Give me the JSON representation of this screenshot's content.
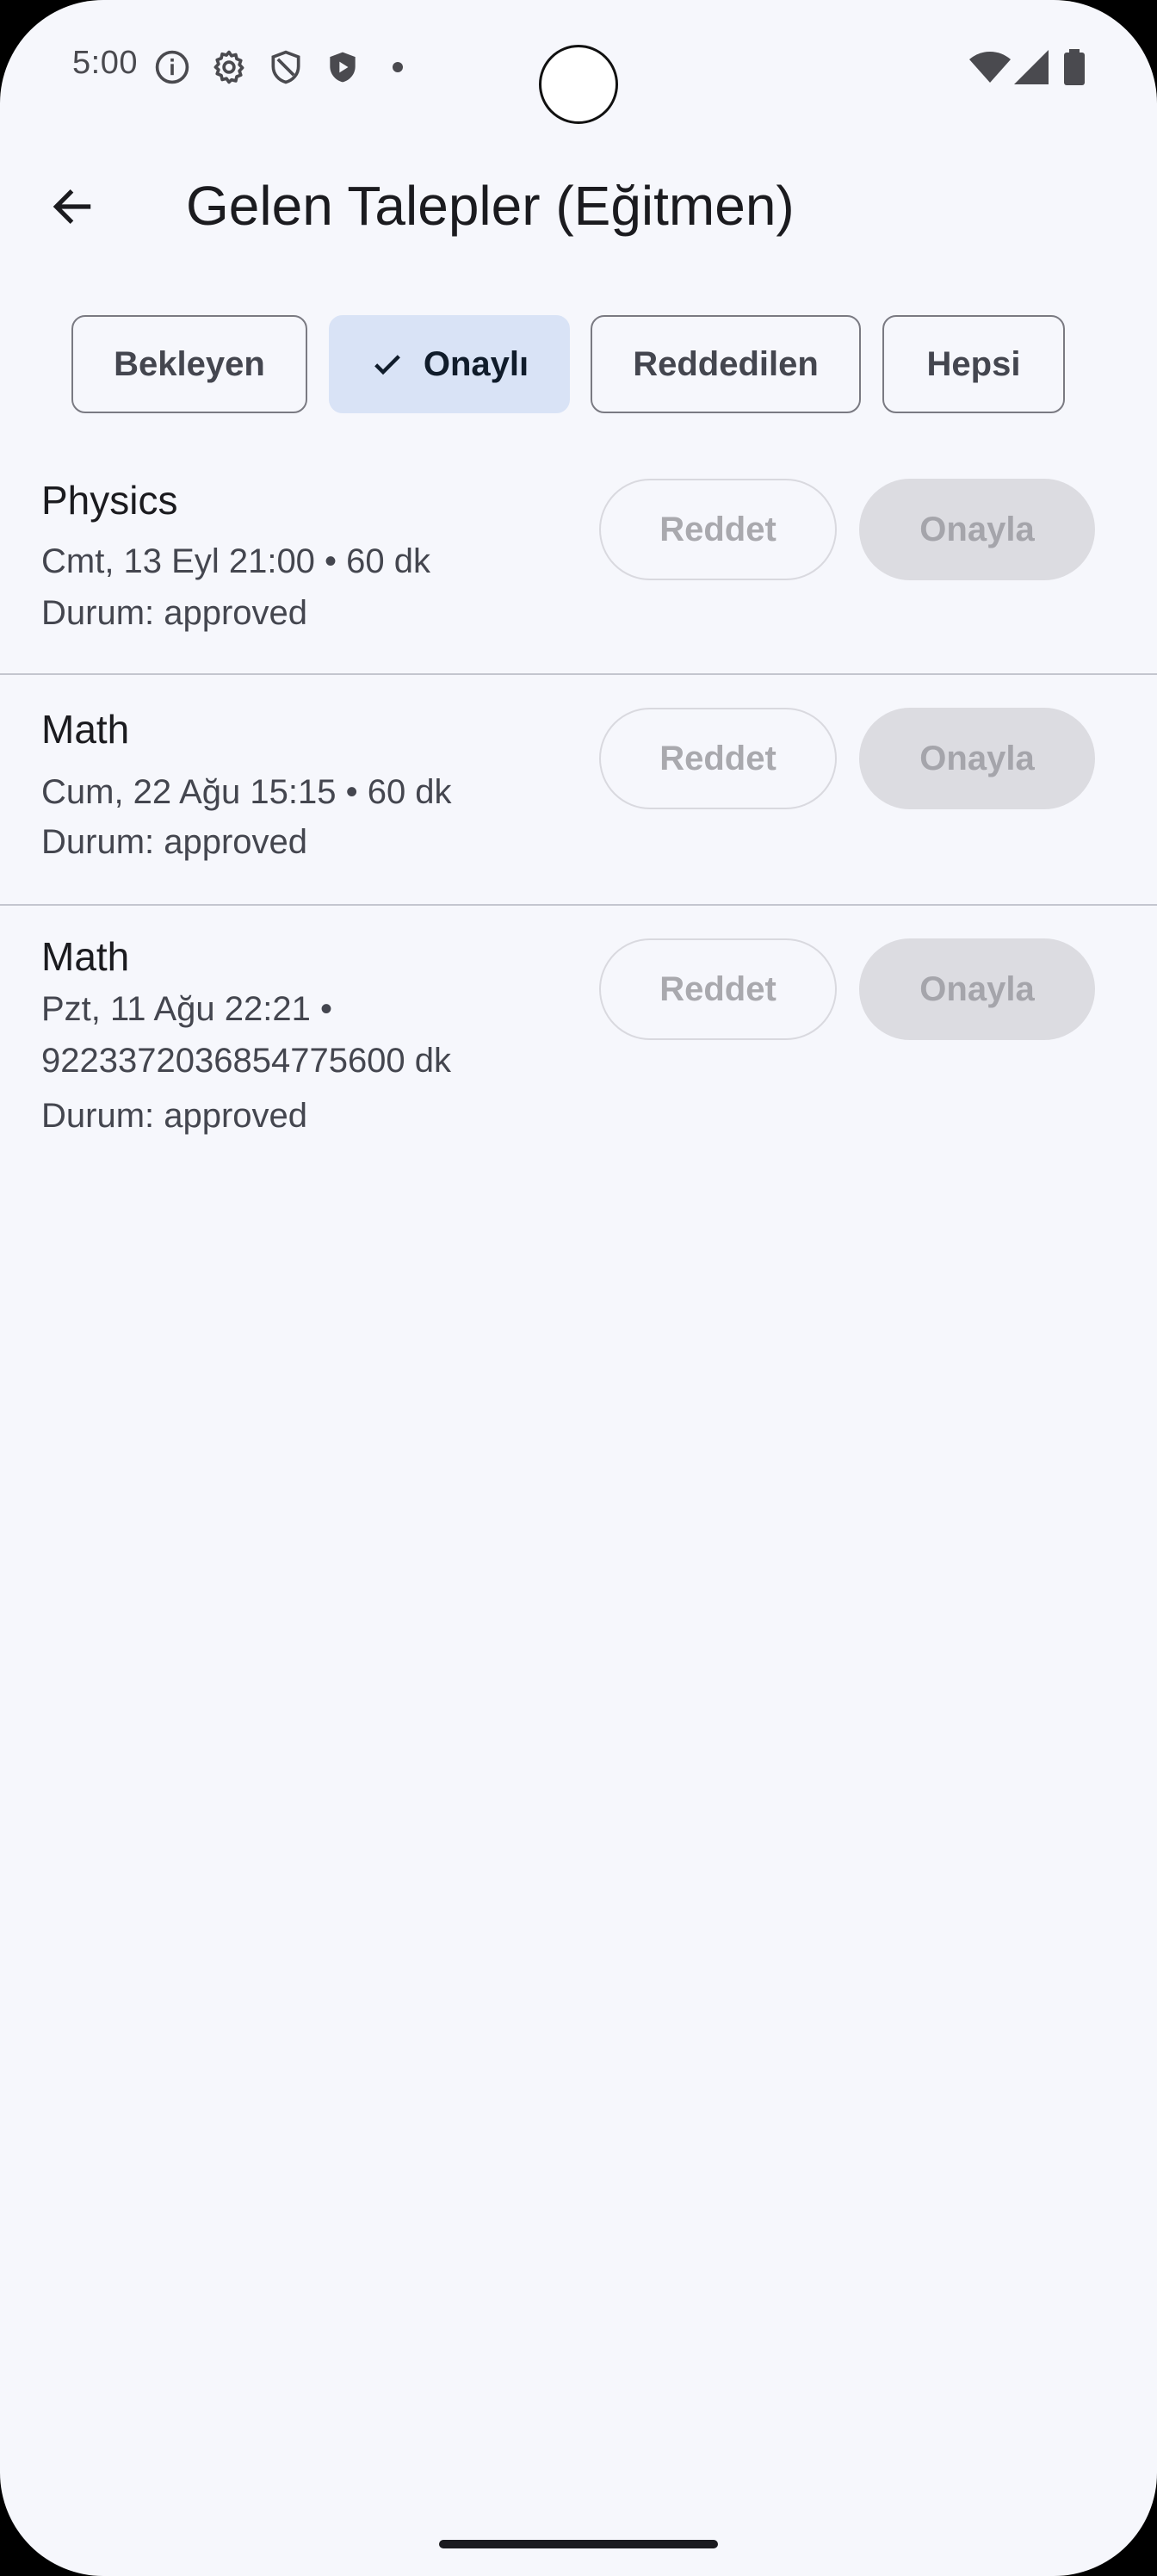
{
  "status_bar": {
    "time": "5:00",
    "left_icons": [
      "info-icon",
      "gear-icon",
      "shield-icon",
      "shield-play-icon"
    ],
    "right_icons": [
      "wifi-icon",
      "signal-icon",
      "battery-icon"
    ]
  },
  "app_bar": {
    "back_icon": "arrow-left-icon",
    "title": "Gelen Talepler (Eğitmen)"
  },
  "filters": {
    "selected": "Onaylı",
    "chips": [
      {
        "label": "Bekleyen",
        "selected": false
      },
      {
        "label": "Onaylı",
        "selected": true
      },
      {
        "label": "Reddedilen",
        "selected": false
      },
      {
        "label": "Hepsi",
        "selected": false
      }
    ]
  },
  "requests": [
    {
      "course": "Physics",
      "detail": "Cmt, 13 Eyl 21:00 • 60 dk",
      "status": "Durum: approved",
      "reject_label": "Reddet",
      "approve_label": "Onayla"
    },
    {
      "course": "Math",
      "detail": "Cum, 22 Ağu 15:15 • 60 dk",
      "status": "Durum: approved",
      "reject_label": "Reddet",
      "approve_label": "Onayla"
    },
    {
      "course": "Math",
      "detail_line1": "Pzt, 11 Ağu 22:21 •",
      "detail_line2": "9223372036854775600 dk",
      "status": "Durum: approved",
      "reject_label": "Reddet",
      "approve_label": "Onayla"
    }
  ],
  "colors": {
    "background": "#f6f7fc",
    "selected_chip": "#d9e3f6",
    "disabled_button": "#dcdce1"
  }
}
